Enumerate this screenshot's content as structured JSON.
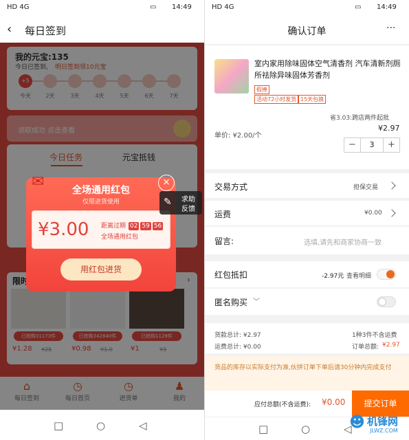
{
  "left": {
    "status": {
      "time": "14:49",
      "signal": "HD 4G"
    },
    "header": {
      "title": "每日签到"
    },
    "points": {
      "title": "我的元宝:135",
      "signed_text": "今日已签到,",
      "tomorrow_text": "明日签到领10元宝"
    },
    "days": [
      {
        "badge": "+5",
        "label": "今天"
      },
      {
        "badge": "",
        "label": "2天"
      },
      {
        "badge": "",
        "label": "3天"
      },
      {
        "badge": "",
        "label": "4天"
      },
      {
        "badge": "",
        "label": "5天"
      },
      {
        "badge": "",
        "label": "6天"
      },
      {
        "badge": "",
        "label": "7天"
      }
    ],
    "claim_banner": "领取成功 点击查看",
    "tabs": [
      "今日任务",
      "元宝抵钱"
    ],
    "popup": {
      "title": "全场通用红包",
      "subtitle": "仅限进货使用",
      "amount": "¥3.00",
      "expiry_label": "距离过期",
      "hours": "02",
      "minutes": "59",
      "seconds": "56",
      "coupon_desc": "全场通用红包",
      "button": "用红包进货"
    },
    "side_float": {
      "line1": "求助",
      "line2": "反馈"
    },
    "limited_label": "限时",
    "products": [
      {
        "sold": "已抢购31173件",
        "price": "¥1.28",
        "orig": "¥25"
      },
      {
        "sold": "已抢购342840件",
        "price": "¥0.98",
        "orig": "¥1.9"
      },
      {
        "sold": "已抢购1128件",
        "price": "¥1",
        "orig": "¥3"
      }
    ],
    "tabbar": [
      {
        "icon": "home-icon",
        "label": "每日签到"
      },
      {
        "icon": "clock-icon",
        "label": "每日首页"
      },
      {
        "icon": "clock-icon",
        "label": "进货单"
      },
      {
        "icon": "user-icon",
        "label": "我的"
      }
    ]
  },
  "right": {
    "status": {
      "time": "14:49",
      "signal": "HD 4G"
    },
    "header": {
      "title": "确认订单",
      "more": "···"
    },
    "product": {
      "title": "室内家用除味固体空气清香剂 汽车清新剂厕所祛除异味固体芳香剂",
      "tag": "假捧",
      "badges": [
        "活动72小时发货",
        "15天包换"
      ],
      "promo": "省3.03:跨店两件起批",
      "price_label": "单价: ¥2.00/个",
      "price": "¥2.97",
      "qty": "3",
      "minus": "−",
      "plus": "+"
    },
    "trade_mode": {
      "label": "交易方式",
      "value": "担保交易"
    },
    "shipping": {
      "label": "运费",
      "value": "¥0.00"
    },
    "message": {
      "label": "留言:",
      "placeholder": "选填,请先和商家协商一致"
    },
    "red_packet": {
      "label": "红包抵扣",
      "value": "-2.97元",
      "link": "查看明细"
    },
    "anonymous": {
      "label": "匿名购买"
    },
    "summary": {
      "goods_total": "货款总计: ¥2.97",
      "shipping_total": "运费总计: ¥0.00",
      "count": "1种3件不含运费",
      "order_total_label": "订单总额:",
      "order_total": "¥2.97"
    },
    "notice": "货品的库存以实际支付为准,伙拼订单下单后请30分钟内完成支付",
    "footer": {
      "total_label": "应付总额(不含运费):",
      "total": "¥0.00",
      "submit": "提交订单"
    },
    "watermark": {
      "line1": "机锋网",
      "line2": "JLWZ.COM"
    }
  }
}
